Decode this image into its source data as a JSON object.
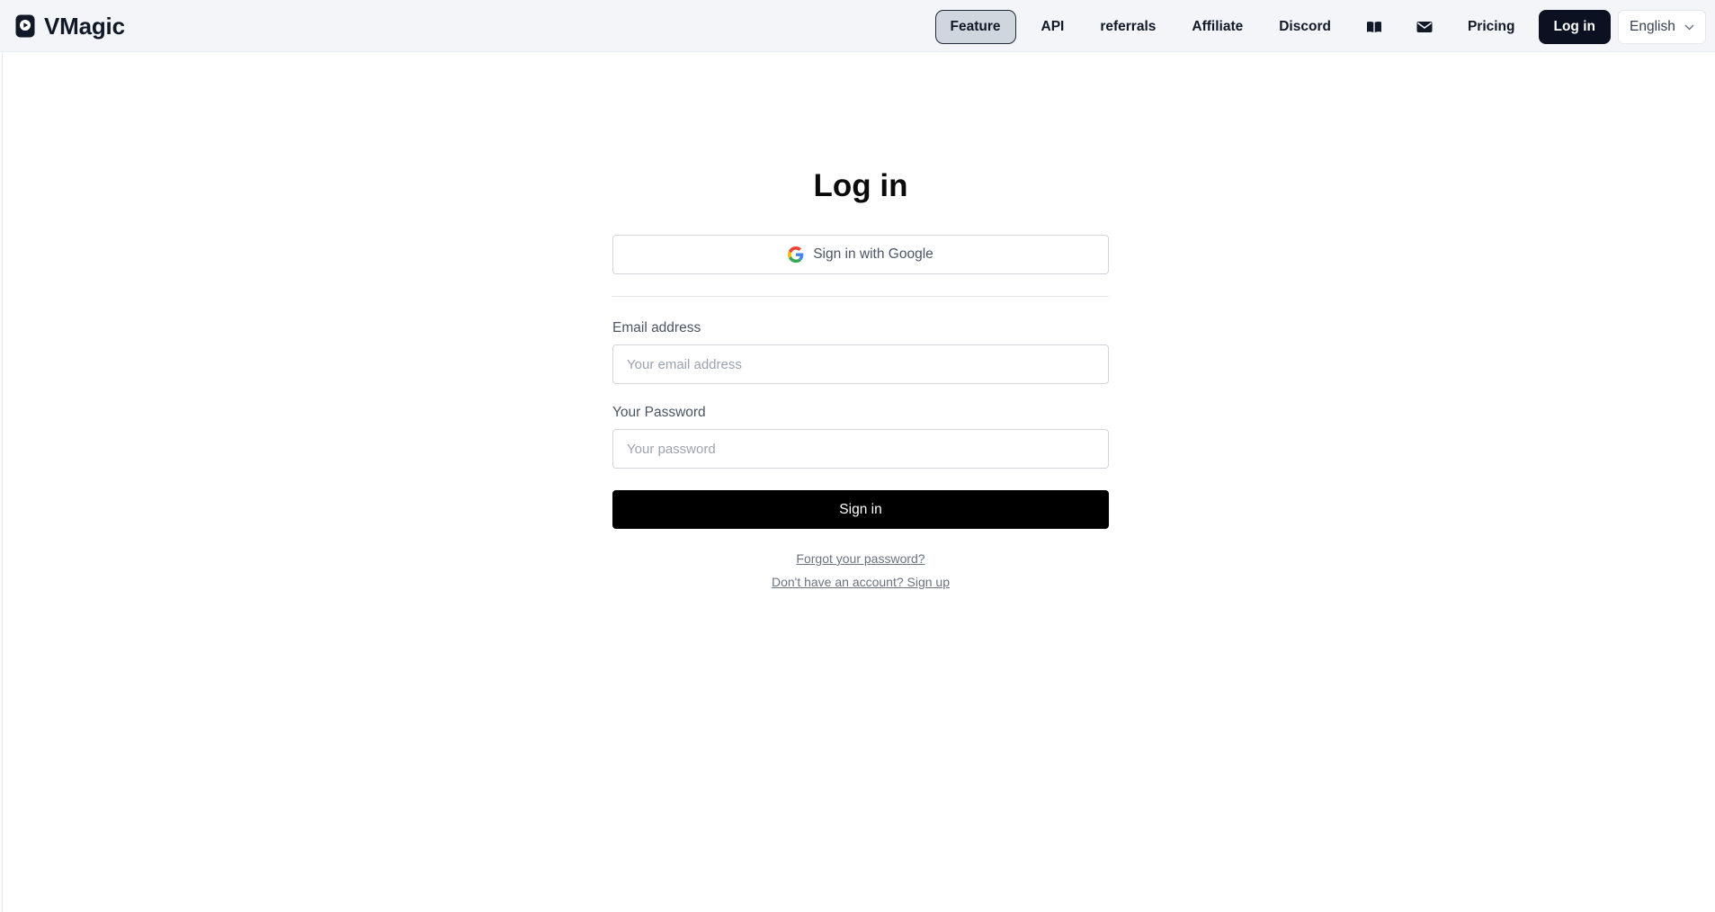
{
  "header": {
    "brand_name": "VMagic",
    "nav": [
      {
        "label": "Feature",
        "active": true
      },
      {
        "label": "API"
      },
      {
        "label": "referrals"
      },
      {
        "label": "Affiliate"
      },
      {
        "label": "Discord"
      }
    ],
    "icons": [
      "book-icon",
      "mail-icon"
    ],
    "pricing_label": "Pricing",
    "login_label": "Log in",
    "language": {
      "selected": "English"
    }
  },
  "auth": {
    "title": "Log in",
    "google_label": "Sign in with Google",
    "email_label": "Email address",
    "email_placeholder": "Your email address",
    "email_value": "",
    "password_label": "Your Password",
    "password_placeholder": "Your password",
    "password_value": "",
    "signin_label": "Sign in",
    "forgot_link": "Forgot your password?",
    "signup_link": "Don't have an account? Sign up"
  },
  "colors": {
    "header_bg": "#f3f5f8",
    "active_nav_bg": "#cfd6de",
    "primary_button": "#000000",
    "login_button": "#0b1120"
  }
}
